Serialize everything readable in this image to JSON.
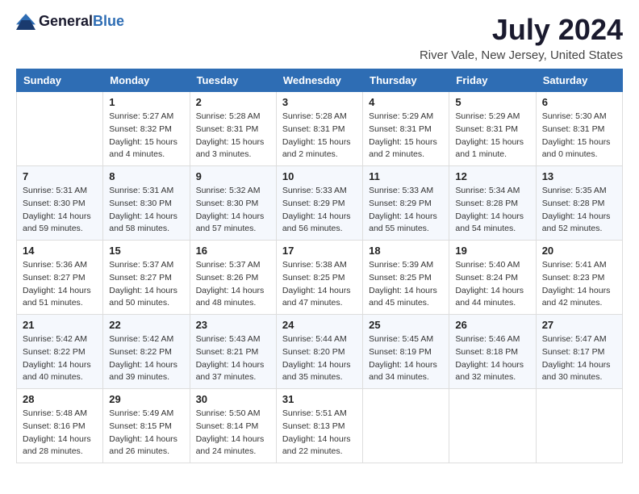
{
  "logo": {
    "text_general": "General",
    "text_blue": "Blue"
  },
  "title": "July 2024",
  "subtitle": "River Vale, New Jersey, United States",
  "days_of_week": [
    "Sunday",
    "Monday",
    "Tuesday",
    "Wednesday",
    "Thursday",
    "Friday",
    "Saturday"
  ],
  "weeks": [
    [
      {
        "day": "",
        "sunrise": "",
        "sunset": "",
        "daylight": ""
      },
      {
        "day": "1",
        "sunrise": "Sunrise: 5:27 AM",
        "sunset": "Sunset: 8:32 PM",
        "daylight": "Daylight: 15 hours and 4 minutes."
      },
      {
        "day": "2",
        "sunrise": "Sunrise: 5:28 AM",
        "sunset": "Sunset: 8:31 PM",
        "daylight": "Daylight: 15 hours and 3 minutes."
      },
      {
        "day": "3",
        "sunrise": "Sunrise: 5:28 AM",
        "sunset": "Sunset: 8:31 PM",
        "daylight": "Daylight: 15 hours and 2 minutes."
      },
      {
        "day": "4",
        "sunrise": "Sunrise: 5:29 AM",
        "sunset": "Sunset: 8:31 PM",
        "daylight": "Daylight: 15 hours and 2 minutes."
      },
      {
        "day": "5",
        "sunrise": "Sunrise: 5:29 AM",
        "sunset": "Sunset: 8:31 PM",
        "daylight": "Daylight: 15 hours and 1 minute."
      },
      {
        "day": "6",
        "sunrise": "Sunrise: 5:30 AM",
        "sunset": "Sunset: 8:31 PM",
        "daylight": "Daylight: 15 hours and 0 minutes."
      }
    ],
    [
      {
        "day": "7",
        "sunrise": "Sunrise: 5:31 AM",
        "sunset": "Sunset: 8:30 PM",
        "daylight": "Daylight: 14 hours and 59 minutes."
      },
      {
        "day": "8",
        "sunrise": "Sunrise: 5:31 AM",
        "sunset": "Sunset: 8:30 PM",
        "daylight": "Daylight: 14 hours and 58 minutes."
      },
      {
        "day": "9",
        "sunrise": "Sunrise: 5:32 AM",
        "sunset": "Sunset: 8:30 PM",
        "daylight": "Daylight: 14 hours and 57 minutes."
      },
      {
        "day": "10",
        "sunrise": "Sunrise: 5:33 AM",
        "sunset": "Sunset: 8:29 PM",
        "daylight": "Daylight: 14 hours and 56 minutes."
      },
      {
        "day": "11",
        "sunrise": "Sunrise: 5:33 AM",
        "sunset": "Sunset: 8:29 PM",
        "daylight": "Daylight: 14 hours and 55 minutes."
      },
      {
        "day": "12",
        "sunrise": "Sunrise: 5:34 AM",
        "sunset": "Sunset: 8:28 PM",
        "daylight": "Daylight: 14 hours and 54 minutes."
      },
      {
        "day": "13",
        "sunrise": "Sunrise: 5:35 AM",
        "sunset": "Sunset: 8:28 PM",
        "daylight": "Daylight: 14 hours and 52 minutes."
      }
    ],
    [
      {
        "day": "14",
        "sunrise": "Sunrise: 5:36 AM",
        "sunset": "Sunset: 8:27 PM",
        "daylight": "Daylight: 14 hours and 51 minutes."
      },
      {
        "day": "15",
        "sunrise": "Sunrise: 5:37 AM",
        "sunset": "Sunset: 8:27 PM",
        "daylight": "Daylight: 14 hours and 50 minutes."
      },
      {
        "day": "16",
        "sunrise": "Sunrise: 5:37 AM",
        "sunset": "Sunset: 8:26 PM",
        "daylight": "Daylight: 14 hours and 48 minutes."
      },
      {
        "day": "17",
        "sunrise": "Sunrise: 5:38 AM",
        "sunset": "Sunset: 8:25 PM",
        "daylight": "Daylight: 14 hours and 47 minutes."
      },
      {
        "day": "18",
        "sunrise": "Sunrise: 5:39 AM",
        "sunset": "Sunset: 8:25 PM",
        "daylight": "Daylight: 14 hours and 45 minutes."
      },
      {
        "day": "19",
        "sunrise": "Sunrise: 5:40 AM",
        "sunset": "Sunset: 8:24 PM",
        "daylight": "Daylight: 14 hours and 44 minutes."
      },
      {
        "day": "20",
        "sunrise": "Sunrise: 5:41 AM",
        "sunset": "Sunset: 8:23 PM",
        "daylight": "Daylight: 14 hours and 42 minutes."
      }
    ],
    [
      {
        "day": "21",
        "sunrise": "Sunrise: 5:42 AM",
        "sunset": "Sunset: 8:22 PM",
        "daylight": "Daylight: 14 hours and 40 minutes."
      },
      {
        "day": "22",
        "sunrise": "Sunrise: 5:42 AM",
        "sunset": "Sunset: 8:22 PM",
        "daylight": "Daylight: 14 hours and 39 minutes."
      },
      {
        "day": "23",
        "sunrise": "Sunrise: 5:43 AM",
        "sunset": "Sunset: 8:21 PM",
        "daylight": "Daylight: 14 hours and 37 minutes."
      },
      {
        "day": "24",
        "sunrise": "Sunrise: 5:44 AM",
        "sunset": "Sunset: 8:20 PM",
        "daylight": "Daylight: 14 hours and 35 minutes."
      },
      {
        "day": "25",
        "sunrise": "Sunrise: 5:45 AM",
        "sunset": "Sunset: 8:19 PM",
        "daylight": "Daylight: 14 hours and 34 minutes."
      },
      {
        "day": "26",
        "sunrise": "Sunrise: 5:46 AM",
        "sunset": "Sunset: 8:18 PM",
        "daylight": "Daylight: 14 hours and 32 minutes."
      },
      {
        "day": "27",
        "sunrise": "Sunrise: 5:47 AM",
        "sunset": "Sunset: 8:17 PM",
        "daylight": "Daylight: 14 hours and 30 minutes."
      }
    ],
    [
      {
        "day": "28",
        "sunrise": "Sunrise: 5:48 AM",
        "sunset": "Sunset: 8:16 PM",
        "daylight": "Daylight: 14 hours and 28 minutes."
      },
      {
        "day": "29",
        "sunrise": "Sunrise: 5:49 AM",
        "sunset": "Sunset: 8:15 PM",
        "daylight": "Daylight: 14 hours and 26 minutes."
      },
      {
        "day": "30",
        "sunrise": "Sunrise: 5:50 AM",
        "sunset": "Sunset: 8:14 PM",
        "daylight": "Daylight: 14 hours and 24 minutes."
      },
      {
        "day": "31",
        "sunrise": "Sunrise: 5:51 AM",
        "sunset": "Sunset: 8:13 PM",
        "daylight": "Daylight: 14 hours and 22 minutes."
      },
      {
        "day": "",
        "sunrise": "",
        "sunset": "",
        "daylight": ""
      },
      {
        "day": "",
        "sunrise": "",
        "sunset": "",
        "daylight": ""
      },
      {
        "day": "",
        "sunrise": "",
        "sunset": "",
        "daylight": ""
      }
    ]
  ]
}
